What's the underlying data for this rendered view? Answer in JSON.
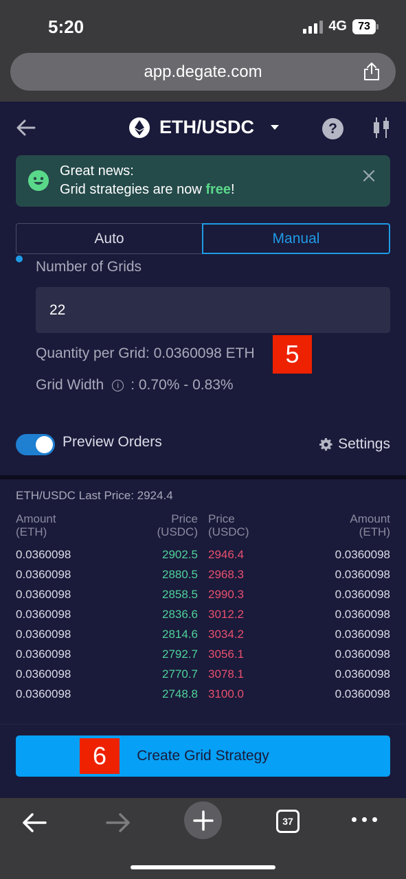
{
  "status_bar": {
    "time": "5:20",
    "network": "4G",
    "battery": "73"
  },
  "browser": {
    "url": "app.degate.com",
    "tab_count": "37"
  },
  "header": {
    "pair": "ETH/USDC"
  },
  "banner": {
    "line1": "Great news:",
    "line2_prefix": "Grid strategies are now ",
    "line2_highlight": "free",
    "line2_suffix": "!"
  },
  "mode_tabs": {
    "auto": "Auto",
    "manual": "Manual",
    "selected": "Manual"
  },
  "form": {
    "grids_label": "Number of Grids",
    "grids_value": "22",
    "quantity_text": "Quantity per Grid: 0.0360098 ETH",
    "grid_width_label": "Grid Width",
    "grid_width_value": ": 0.70% - 0.83%",
    "preview_label": "Preview Orders",
    "preview_enabled": true,
    "settings_label": "Settings"
  },
  "annotations": {
    "badge_a": "5",
    "badge_b": "6"
  },
  "order_book": {
    "last_price_text": "ETH/USDC Last Price: 2924.4",
    "headers": {
      "buy_amount": [
        "Amount",
        "(ETH)"
      ],
      "buy_price": [
        "Price",
        "(USDC)"
      ],
      "sell_price": [
        "Price",
        "(USDC)"
      ],
      "sell_amount": [
        "Amount",
        "(ETH)"
      ]
    },
    "rows": [
      {
        "buy_amount": "0.0360098",
        "buy_price": "2902.5",
        "sell_price": "2946.4",
        "sell_amount": "0.0360098"
      },
      {
        "buy_amount": "0.0360098",
        "buy_price": "2880.5",
        "sell_price": "2968.3",
        "sell_amount": "0.0360098"
      },
      {
        "buy_amount": "0.0360098",
        "buy_price": "2858.5",
        "sell_price": "2990.3",
        "sell_amount": "0.0360098"
      },
      {
        "buy_amount": "0.0360098",
        "buy_price": "2836.6",
        "sell_price": "3012.2",
        "sell_amount": "0.0360098"
      },
      {
        "buy_amount": "0.0360098",
        "buy_price": "2814.6",
        "sell_price": "3034.2",
        "sell_amount": "0.0360098"
      },
      {
        "buy_amount": "0.0360098",
        "buy_price": "2792.7",
        "sell_price": "3056.1",
        "sell_amount": "0.0360098"
      },
      {
        "buy_amount": "0.0360098",
        "buy_price": "2770.7",
        "sell_price": "3078.1",
        "sell_amount": "0.0360098"
      },
      {
        "buy_amount": "0.0360098",
        "buy_price": "2748.8",
        "sell_price": "3100.0",
        "sell_amount": "0.0360098"
      }
    ]
  },
  "actions": {
    "create_label": "Create Grid Strategy"
  },
  "colors": {
    "app_bg": "#1a1a3a",
    "accent": "#1f9be6",
    "button": "#06a0f6",
    "buy": "#4ed39a",
    "sell": "#e8506e",
    "highlight": "#5ad88a",
    "annotation": "#ee2200"
  },
  "icons": {
    "header": [
      "back-arrow-icon",
      "ethereum-icon",
      "chevron-down-icon",
      "help-icon",
      "candlestick-icon"
    ],
    "banner": [
      "smiley-icon",
      "close-icon"
    ],
    "browser": [
      "share-icon",
      "back-icon",
      "forward-icon",
      "plus-icon",
      "tabs-icon",
      "more-icon"
    ]
  }
}
